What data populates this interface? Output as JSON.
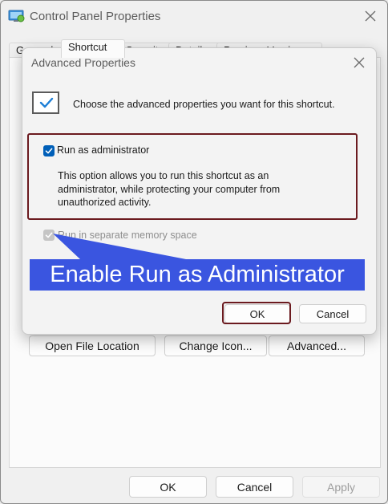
{
  "window": {
    "title": "Control Panel Properties",
    "tabs": [
      "General",
      "Shortcut",
      "Security",
      "Details",
      "Previous Versions"
    ],
    "panel_buttons": {
      "open_file_location": "Open File Location",
      "change_icon": "Change Icon...",
      "advanced": "Advanced..."
    },
    "footer": {
      "ok": "OK",
      "cancel": "Cancel",
      "apply": "Apply"
    }
  },
  "dialog": {
    "title": "Advanced Properties",
    "intro": "Choose the advanced properties you want for this shortcut.",
    "run_as_admin": {
      "label": "Run as administrator",
      "checked": true,
      "description": "This option allows you to run this shortcut as an administrator, while protecting your computer from unauthorized activity."
    },
    "separate_memory": {
      "label": "Run in separate memory space",
      "checked": true,
      "enabled": false
    },
    "buttons": {
      "ok": "OK",
      "cancel": "Cancel"
    }
  },
  "annotation": {
    "text": "Enable Run as Administrator",
    "background": "#3a55e0",
    "highlight_color": "#6b1a1f"
  },
  "colors": {
    "accent": "#005fb8",
    "window_bg": "#f0f0f0",
    "dialog_bg": "#f3f3f3"
  },
  "icons": {
    "app": "control-panel-icon",
    "shortcut": "shortcut-check-icon",
    "close": "close-icon"
  }
}
